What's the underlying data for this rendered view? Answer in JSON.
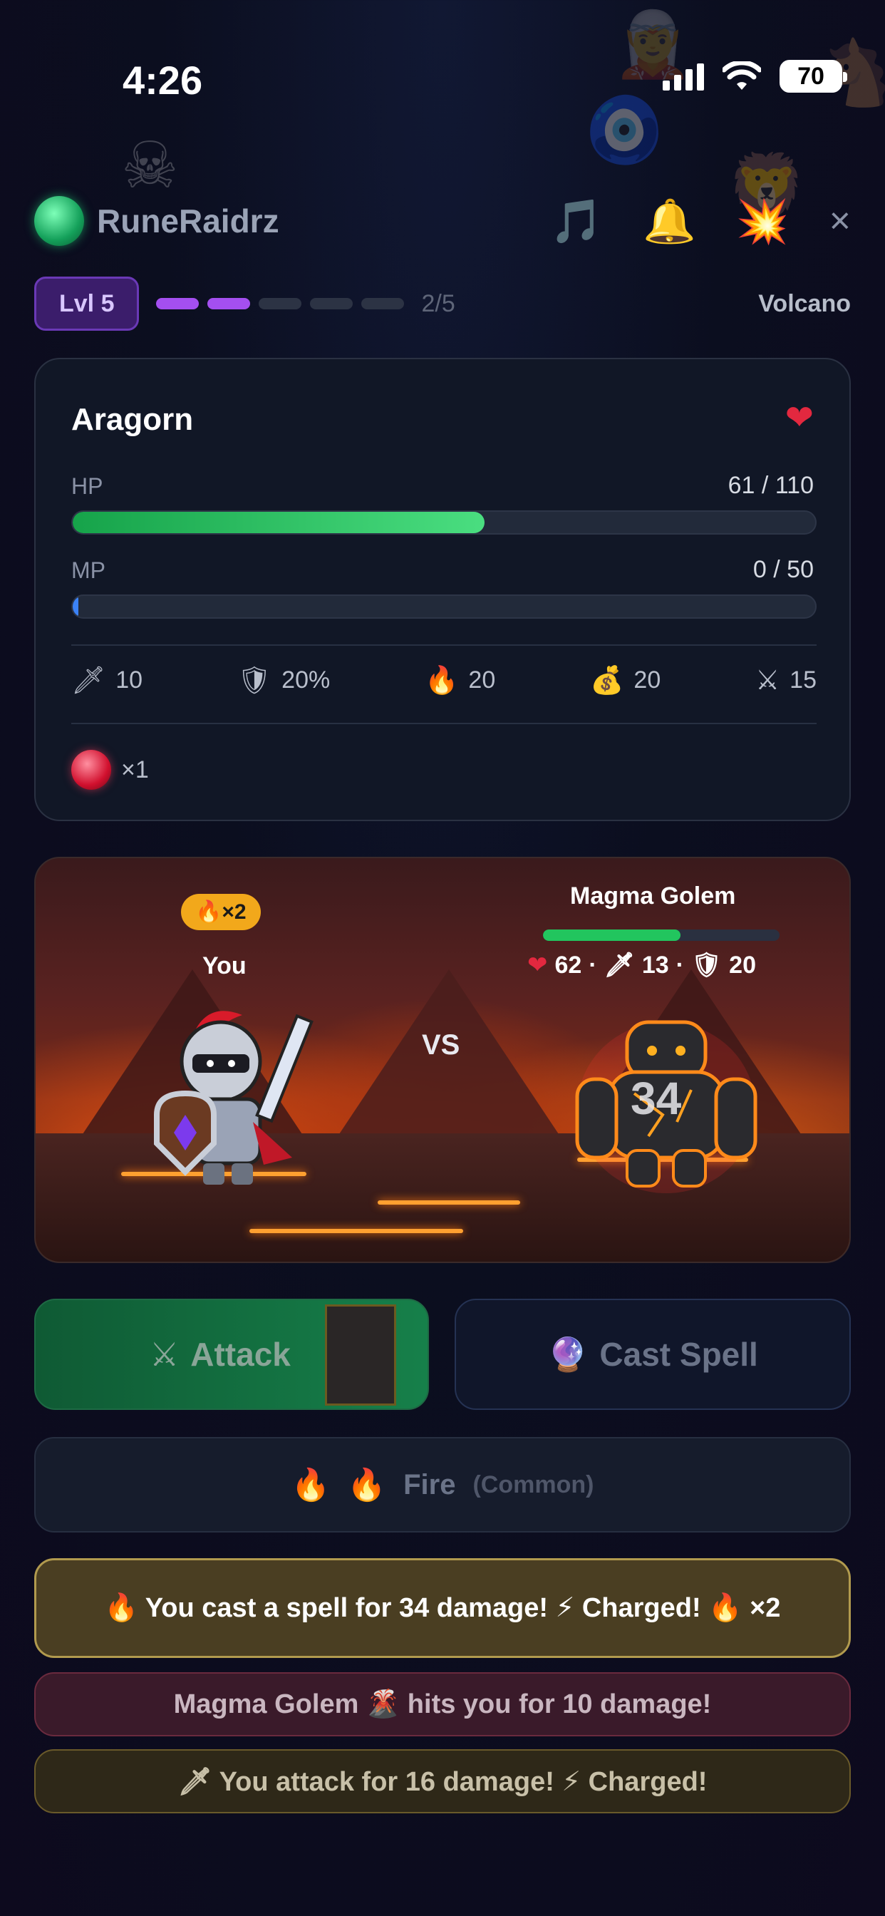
{
  "status_bar": {
    "time": "4:26",
    "battery": "70"
  },
  "header": {
    "app_name": "RuneRaidrz",
    "icons": [
      "music-icon",
      "bell-icon",
      "burst-icon"
    ],
    "close": "×"
  },
  "level": {
    "badge": "Lvl 5",
    "progress": 2,
    "progress_total": 5,
    "progress_text": "2/5",
    "zone": "Volcano"
  },
  "hero": {
    "name": "Aragorn",
    "hp_label": "HP",
    "hp_value": "61 / 110",
    "hp_fraction": 0.5545,
    "mp_label": "MP",
    "mp_value": "0 / 50",
    "mp_fraction": 0,
    "stats": [
      {
        "icon": "dagger-icon",
        "glyph": "🗡",
        "value": "10"
      },
      {
        "icon": "shield-icon",
        "glyph": "🛡",
        "value": "20%"
      },
      {
        "icon": "fire-icon",
        "glyph": "🔥",
        "value": "20"
      },
      {
        "icon": "money-bag-icon",
        "glyph": "💰",
        "value": "20"
      },
      {
        "icon": "crossed-swords-icon",
        "glyph": "⚔",
        "value": "15"
      }
    ],
    "inventory": {
      "icon": "ruby-icon",
      "count": "×1"
    }
  },
  "battle": {
    "charge_badge": "🔥×2",
    "player_label": "You",
    "vs": "VS",
    "enemy_name": "Magma Golem",
    "enemy_hp_fraction": 0.58,
    "enemy_stats": {
      "hp": "62",
      "atk": "13",
      "def": "20"
    },
    "damage_popup": "34"
  },
  "actions": {
    "attack": "Attack",
    "cast_spell": "Cast Spell",
    "spell_name": "Fire",
    "spell_rarity": "(Common)"
  },
  "log": [
    "🔥 You cast a spell for 34 damage! ⚡ Charged! 🔥 ×2",
    "Magma Golem 🌋 hits you for 10 damage!",
    "🗡 You attack for 16 damage! ⚡ Charged!"
  ],
  "colors": {
    "hp": "#22c55e",
    "mp": "#3b82f6",
    "accent": "#a44ff0",
    "charge": "#f2a81b"
  }
}
